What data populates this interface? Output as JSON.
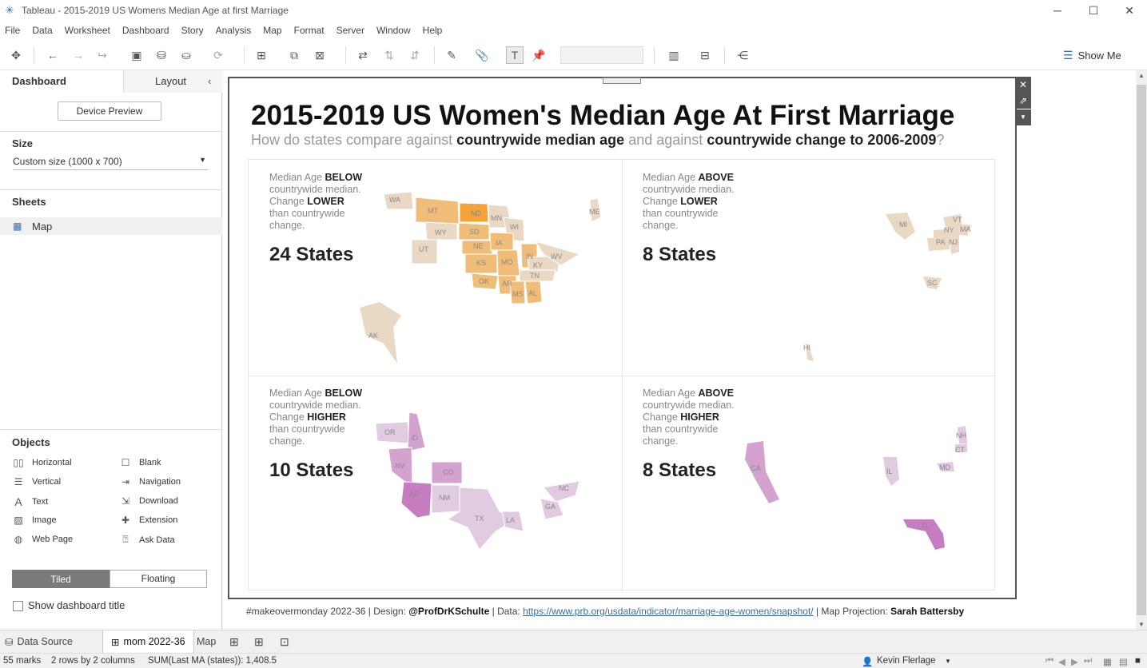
{
  "window": {
    "title": "Tableau - 2015-2019 US Womens Median Age at first Marriage"
  },
  "menu": [
    "File",
    "Data",
    "Worksheet",
    "Dashboard",
    "Story",
    "Analysis",
    "Map",
    "Format",
    "Server",
    "Window",
    "Help"
  ],
  "toolbar": {
    "show_me": "Show Me"
  },
  "sidebar": {
    "tabs": {
      "dashboard": "Dashboard",
      "layout": "Layout"
    },
    "device_preview": "Device Preview",
    "size": {
      "heading": "Size",
      "value": "Custom size (1000 x 700)"
    },
    "sheets": {
      "heading": "Sheets",
      "items": [
        "Map"
      ]
    },
    "objects": {
      "heading": "Objects",
      "items": [
        "Horizontal",
        "Blank",
        "Vertical",
        "Navigation",
        "Text",
        "Download",
        "Image",
        "Extension",
        "Web Page",
        "Ask Data"
      ]
    },
    "tiled": "Tiled",
    "floating": "Floating",
    "show_title": "Show dashboard title"
  },
  "dashboard": {
    "title": "2015-2019 US Women's Median Age At First Marriage",
    "subtitle": {
      "p1": "How do states compare against ",
      "b1": "countrywide median age",
      "p2": " and against ",
      "b2": "countrywide change to 2006-2009",
      "p3": "?"
    },
    "quadrants": [
      {
        "l1a": "Median Age ",
        "l1b": "BELOW",
        "l2": "countrywide median.",
        "l3a": "Change ",
        "l3b": "LOWER",
        "l4": "than countrywide",
        "l5": "change.",
        "count": "24 States"
      },
      {
        "l1a": "Median Age ",
        "l1b": "ABOVE",
        "l2": "countrywide median.",
        "l3a": "Change ",
        "l3b": "LOWER",
        "l4": "than countrywide",
        "l5": "change.",
        "count": "8 States"
      },
      {
        "l1a": "Median Age ",
        "l1b": "BELOW",
        "l2": "countrywide median.",
        "l3a": "Change ",
        "l3b": "HIGHER",
        "l4": "than countrywide",
        "l5": "change.",
        "count": "10 States"
      },
      {
        "l1a": "Median Age ",
        "l1b": "ABOVE",
        "l2": "countrywide median.",
        "l3a": "Change ",
        "l3b": "HIGHER",
        "l4": "than countrywide",
        "l5": "change.",
        "count": "8 States"
      }
    ],
    "state_labels": {
      "q1": [
        "WA",
        "MT",
        "ND",
        "MN",
        "ME",
        "WY",
        "SD",
        "WI",
        "UT",
        "NE",
        "IA",
        "KS",
        "MO",
        "IN",
        "KY",
        "WV",
        "TN",
        "OK",
        "AR",
        "MS",
        "AL",
        "AK"
      ],
      "q2": [
        "VT",
        "MI",
        "NY",
        "MA",
        "PA",
        "NJ",
        "SC",
        "HI"
      ],
      "q3": [
        "OR",
        "ID",
        "NV",
        "CO",
        "AZ",
        "NM",
        "TX",
        "LA",
        "NC",
        "GA"
      ],
      "q4": [
        "NH",
        "CT",
        "MD",
        "CA",
        "IL",
        "FL"
      ]
    },
    "colors": {
      "orange_dark": "#f5a338",
      "orange_mid": "#f0bd78",
      "orange_light": "#e8d8c4",
      "purple_dark": "#c57dbf",
      "purple_mid": "#d3a2cf",
      "purple_light": "#e1cbe0"
    }
  },
  "footer": {
    "p1": "#makeovermonday 2022-36 | Design: ",
    "designer": "@ProfDrKSchulte",
    "p2": " | Data: ",
    "url": "https://www.prb.org/usdata/indicator/marriage-age-women/snapshot/",
    "p3": " | Map Projection: ",
    "projection": "Sarah Battersby"
  },
  "tabs": {
    "data_source": "Data Source",
    "dashboard": "mom 2022-36",
    "sheet": "Map"
  },
  "status": {
    "marks": "55 marks",
    "rows": "2 rows by 2 columns",
    "sum": "SUM(Last MA (states)): 1,408.5",
    "user": "Kevin Flerlage"
  }
}
